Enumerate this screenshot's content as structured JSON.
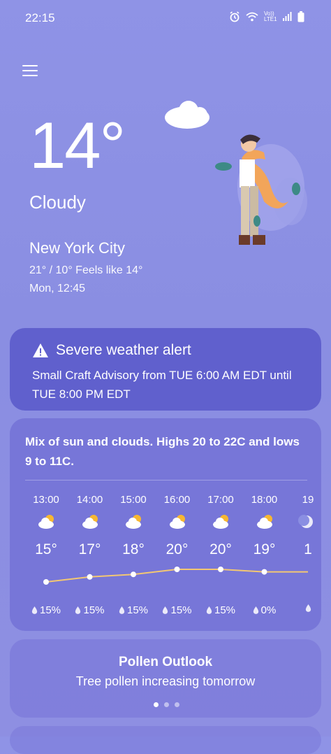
{
  "status_bar": {
    "time": "22:15",
    "network_label": "Vo)) LTE1"
  },
  "current": {
    "temperature": "14°",
    "condition": "Cloudy",
    "city": "New York City",
    "hi_lo_feels": "21° / 10° Feels like 14°",
    "date_time": "Mon, 12:45"
  },
  "alert": {
    "title": "Severe weather alert",
    "text": "Small Craft Advisory from TUE 6:00 AM EDT until TUE 8:00 PM EDT"
  },
  "forecast": {
    "summary": "Mix of sun and clouds. Highs 20 to 22C and lows 9 to 11C.",
    "hours": [
      {
        "time": "13:00",
        "temp": "15°",
        "precip": "15%",
        "icon": "partly-cloudy-icon",
        "temp_value": 15
      },
      {
        "time": "14:00",
        "temp": "17°",
        "precip": "15%",
        "icon": "partly-cloudy-icon",
        "temp_value": 17
      },
      {
        "time": "15:00",
        "temp": "18°",
        "precip": "15%",
        "icon": "partly-cloudy-icon",
        "temp_value": 18
      },
      {
        "time": "16:00",
        "temp": "20°",
        "precip": "15%",
        "icon": "partly-cloudy-icon",
        "temp_value": 20
      },
      {
        "time": "17:00",
        "temp": "20°",
        "precip": "15%",
        "icon": "partly-cloudy-icon",
        "temp_value": 20
      },
      {
        "time": "18:00",
        "temp": "19°",
        "precip": "0%",
        "icon": "partly-cloudy-icon",
        "temp_value": 19
      },
      {
        "time": "19",
        "temp": "1",
        "precip": "",
        "icon": "moon-icon",
        "temp_value": 19
      }
    ]
  },
  "pollen": {
    "title": "Pollen Outlook",
    "text": "Tree pollen increasing tomorrow",
    "page_count": 3,
    "active_page": 1
  },
  "colors": {
    "background": "#8f93e6",
    "alert_card": "#6060cd",
    "temp_line": "#f3c772",
    "sun": "#f7b731"
  }
}
